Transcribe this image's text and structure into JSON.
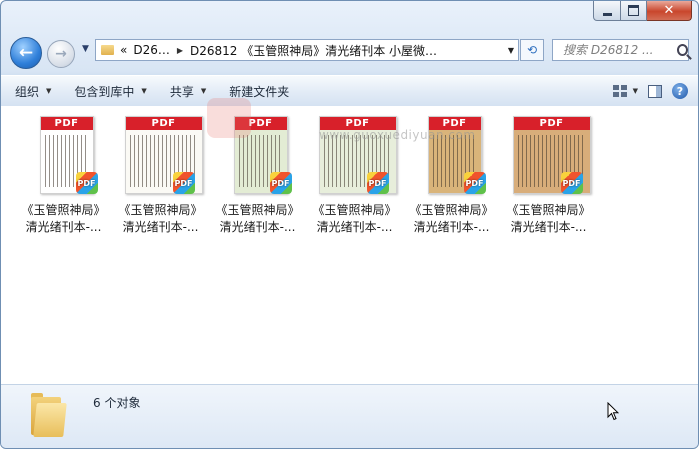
{
  "window": {
    "controls": {
      "minimize_icon": "minimize-icon",
      "maximize_icon": "maximize-icon",
      "close_icon": "close-icon"
    }
  },
  "nav": {
    "back_glyph": "←",
    "forward_glyph": "→",
    "history_glyph": "▼",
    "breadcrumbs": [
      "D26…",
      "D26812 《玉管照神局》清光绪刊本 小屋微…"
    ],
    "overflow": "«",
    "dropdown_glyph": "▼",
    "refresh_glyph": "⟲",
    "search_placeholder": "搜索 D26812 ..."
  },
  "toolbar": {
    "organize": "组织",
    "include": "包含到库中",
    "share": "共享",
    "new_folder": "新建文件夹",
    "help": "?"
  },
  "files": [
    {
      "line1": "《玉管照神局》",
      "line2": "清光绪刊本-...",
      "tone": "#ffffff",
      "wide": false
    },
    {
      "line1": "《玉管照神局》",
      "line2": "清光绪刊本-...",
      "tone": "#fbfaf5",
      "wide": true
    },
    {
      "line1": "《玉管照神局》",
      "line2": "清光绪刊本-...",
      "tone": "#e3ecd4",
      "wide": false
    },
    {
      "line1": "《玉管照神局》",
      "line2": "清光绪刊本-...",
      "tone": "#e7eedb",
      "wide": true
    },
    {
      "line1": "《玉管照神局》",
      "line2": "清光绪刊本-...",
      "tone": "#d9b47a",
      "wide": false
    },
    {
      "line1": "《玉管照神局》",
      "line2": "清光绪刊本-...",
      "tone": "#d8ad7a",
      "wide": true
    }
  ],
  "file_type_label": "PDF",
  "watermark": {
    "url": "www.guoxuediyuan.com"
  },
  "status": {
    "text": "6 个对象"
  }
}
